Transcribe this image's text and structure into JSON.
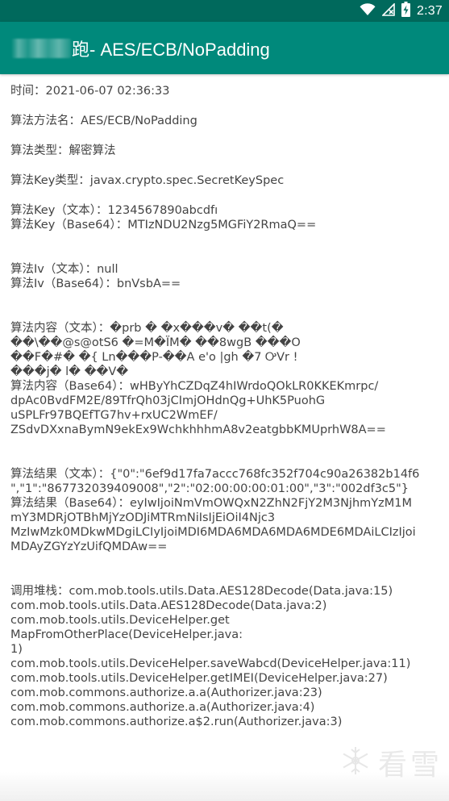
{
  "status_bar": {
    "time": "2:37",
    "icons": [
      "wifi-icon",
      "no-signal-icon",
      "battery-charging-icon"
    ]
  },
  "app_bar": {
    "title_visible": "跑- AES/ECB/NoPadding",
    "background": "#00897b",
    "status_background": "#00695c"
  },
  "content": {
    "time_line": "时间：2021-06-07 02:36:33",
    "algo_method": "算法方法名：AES/ECB/NoPadding",
    "algo_type": "算法类型：解密算法",
    "key_type": "算法Key类型：javax.crypto.spec.SecretKeySpec",
    "key_text": "算法Key（文本）：1234567890abcdfı",
    "key_base64": "算法Key（Base64）：MTIzNDU2Nzg5MGFiY2RmaQ==",
    "iv_text": "算法Iv（文本）：null",
    "iv_base64": "算法Iv（Base64）：bnVsbA==",
    "content_text_1": "算法内容（文本）：�prb � �x���v� ��t(�",
    "content_text_2": "��\\��@s@otS6 �=M�ÏM� ��8wgB ���O",
    "content_text_3": "��F�#� �{  Ln���P-��A e'o |gh �7  ᎤVr !",
    "content_text_4": " ���j� l� ��V�",
    "content_b64_1": "算法内容（Base64）：wHByYhCZDqZ4hIWrdoQOkLR0KKEKmrpc/",
    "content_b64_2": "dpAc0BvdFM2E/89TfrQh03jCImjOHdnQg+UhK5PuohG",
    "content_b64_3": "uSPLFr97BQEfTG7hv+rxUC2WmEF/",
    "content_b64_4": "ZSdvDXxnaBymN9ekEx9WchkhhhmA8v2eatgbbKMUprhW8A==",
    "result_text_1": "算法结果（文本）：{\"0\":\"6ef9d17fa7accc768fc352f704c90a26382b14f6",
    "result_text_2": "\",\"1\":\"867732039409008\",\"2\":\"02:00:00:00:01:00\",\"3\":\"002df3c5\"}",
    "result_b64_1": "算法结果（Base64）：eyIwIjoiNmVmOWQxN2ZhN2FjY2M3NjhmYzM1M",
    "result_b64_2": "mY3MDRjOTBhMjYzODJiMTRmNiIsIjEiOiI4Njc3",
    "result_b64_3": "MzIwMzk0MDkwMDgiLCIyIjoiMDI6MDA6MDA6MDA6MDE6MDAiLCIzIjoi",
    "result_b64_4": "MDAyZGYzYzUifQMDAw==",
    "stack_1": "调用堆栈：com.mob.tools.utils.Data.AES128Decode(Data.java:15)",
    "stack_2": "com.mob.tools.utils.Data.AES128Decode(Data.java:2)",
    "stack_3": "com.mob.tools.utils.DeviceHelper.get",
    "stack_4": "MapFromOtherPlace(DeviceHelper.java:",
    "stack_5": "1)",
    "stack_6": "com.mob.tools.utils.DeviceHelper.saveWabcd(DeviceHelper.java:11)",
    "stack_7": "com.mob.tools.utils.DeviceHelper.getIMEI(DeviceHelper.java:27)",
    "stack_8": "com.mob.commons.authorize.a.a(Authorizer.java:23)",
    "stack_9": "com.mob.commons.authorize.a.a(Authorizer.java:4)",
    "stack_10": "com.mob.commons.authorize.a$2.run(Authorizer.java:3)"
  },
  "watermark": {
    "text": "看雪",
    "icon": "snowflake-icon"
  }
}
